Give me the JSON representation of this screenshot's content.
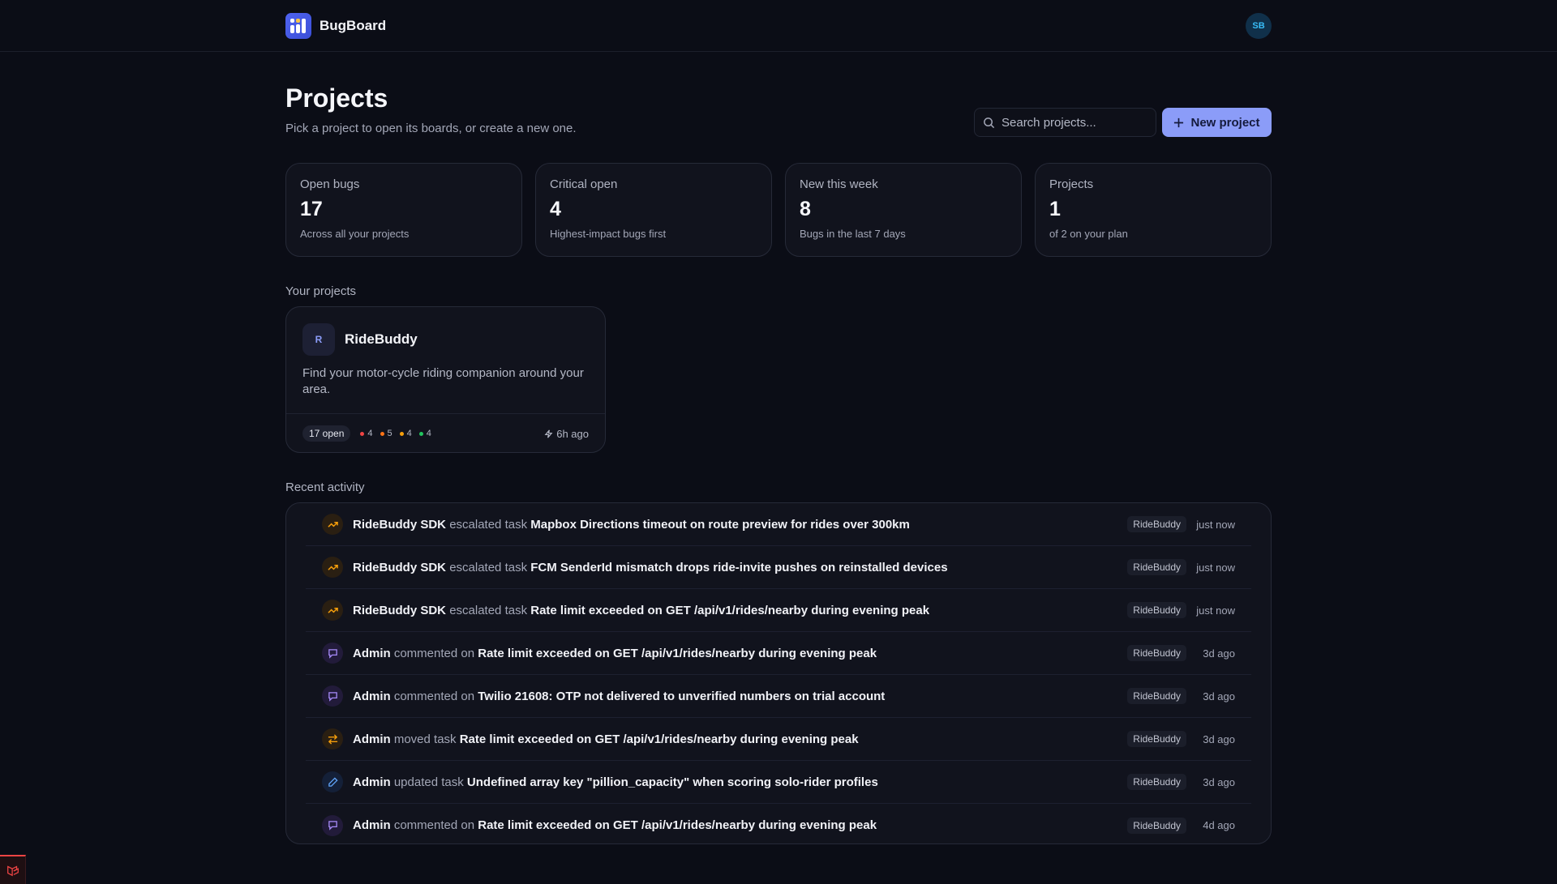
{
  "app": {
    "name": "BugBoard",
    "avatar_initials": "SB"
  },
  "header": {
    "title": "Projects",
    "subtitle": "Pick a project to open its boards, or create a new one.",
    "search_placeholder": "Search projects...",
    "new_project_label": "New project"
  },
  "stats": [
    {
      "label": "Open bugs",
      "value": "17",
      "desc": "Across all your projects"
    },
    {
      "label": "Critical open",
      "value": "4",
      "desc": "Highest-impact bugs first"
    },
    {
      "label": "New this week",
      "value": "8",
      "desc": "Bugs in the last 7 days"
    },
    {
      "label": "Projects",
      "value": "1",
      "desc": "of 2 on your plan"
    }
  ],
  "projects_section": {
    "title": "Your projects",
    "items": [
      {
        "initial": "R",
        "name": "RideBuddy",
        "description": "Find your motor-cycle riding companion around your area.",
        "open_label": "17 open",
        "counts": [
          {
            "value": "4",
            "color": "#ef4444"
          },
          {
            "value": "5",
            "color": "#f97316"
          },
          {
            "value": "4",
            "color": "#f59e0b"
          },
          {
            "value": "4",
            "color": "#22c55e"
          }
        ],
        "updated": "6h ago"
      }
    ]
  },
  "activity_section": {
    "title": "Recent activity",
    "items": [
      {
        "icon": "trend-up-icon",
        "kind": "esc",
        "actor": "RideBuddy SDK",
        "action": "escalated task",
        "target": "Mapbox Directions timeout on route preview for rides over 300km",
        "project": "RideBuddy",
        "time": "just now"
      },
      {
        "icon": "trend-up-icon",
        "kind": "esc",
        "actor": "RideBuddy SDK",
        "action": "escalated task",
        "target": "FCM SenderId mismatch drops ride-invite pushes on reinstalled devices",
        "project": "RideBuddy",
        "time": "just now"
      },
      {
        "icon": "trend-up-icon",
        "kind": "esc",
        "actor": "RideBuddy SDK",
        "action": "escalated task",
        "target": "Rate limit exceeded on GET /api/v1/rides/nearby during evening peak",
        "project": "RideBuddy",
        "time": "just now"
      },
      {
        "icon": "comment-icon",
        "kind": "com",
        "actor": "Admin",
        "action": "commented on",
        "target": "Rate limit exceeded on GET /api/v1/rides/nearby during evening peak",
        "project": "RideBuddy",
        "time": "3d ago"
      },
      {
        "icon": "comment-icon",
        "kind": "com",
        "actor": "Admin",
        "action": "commented on",
        "target": "Twilio 21608: OTP not delivered to unverified numbers on trial account",
        "project": "RideBuddy",
        "time": "3d ago"
      },
      {
        "icon": "move-icon",
        "kind": "mov",
        "actor": "Admin",
        "action": "moved task",
        "target": "Rate limit exceeded on GET /api/v1/rides/nearby during evening peak",
        "project": "RideBuddy",
        "time": "3d ago"
      },
      {
        "icon": "pencil-icon",
        "kind": "upd",
        "actor": "Admin",
        "action": "updated task",
        "target": "Undefined array key \"pillion_capacity\" when scoring solo-rider profiles",
        "project": "RideBuddy",
        "time": "3d ago"
      },
      {
        "icon": "comment-icon",
        "kind": "com",
        "actor": "Admin",
        "action": "commented on",
        "target": "Rate limit exceeded on GET /api/v1/rides/nearby during evening peak",
        "project": "RideBuddy",
        "time": "4d ago"
      }
    ]
  },
  "colors": {
    "accent": "#8b9cf8",
    "brand": "#4f63f0",
    "background": "#0b0d16"
  }
}
